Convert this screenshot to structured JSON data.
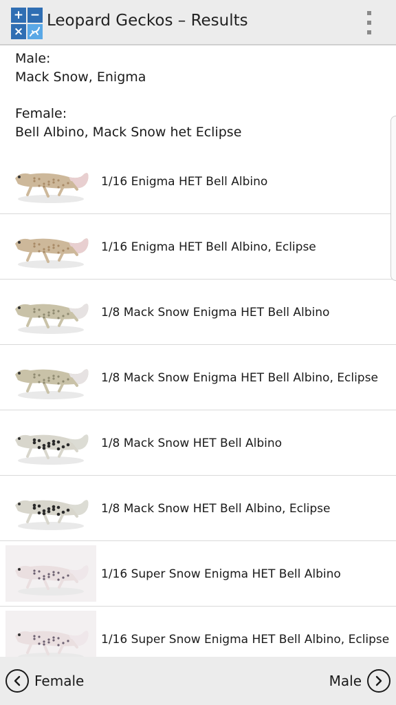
{
  "header": {
    "title": "Leopard Geckos – Results",
    "icon_glyphs": [
      "+",
      "−",
      "×",
      ""
    ],
    "menu_icon": "overflow-menu-icon"
  },
  "parents": {
    "male_label": "Male:",
    "male_value": "Mack Snow, Enigma",
    "female_label": "Female:",
    "female_value": "Bell Albino, Mack Snow het Eclipse"
  },
  "results": [
    {
      "label": "1/16 Enigma HET Bell Albino",
      "morph": "enigma-albino"
    },
    {
      "label": "1/16 Enigma HET Bell Albino, Eclipse",
      "morph": "enigma-albino"
    },
    {
      "label": "1/8 Mack Snow Enigma HET Bell Albino",
      "morph": "mack-snow-enigma"
    },
    {
      "label": "1/8 Mack Snow Enigma HET Bell Albino, Eclipse",
      "morph": "mack-snow-enigma"
    },
    {
      "label": "1/8 Mack Snow HET Bell Albino",
      "morph": "mack-snow"
    },
    {
      "label": "1/8 Mack Snow HET Bell Albino, Eclipse",
      "morph": "mack-snow"
    },
    {
      "label": "1/16 Super Snow Enigma HET Bell Albino",
      "morph": "super-snow-enigma"
    },
    {
      "label": "1/16 Super Snow Enigma HET Bell Albino, Eclipse",
      "morph": "super-snow-enigma"
    }
  ],
  "footer": {
    "prev_label": "Female",
    "next_label": "Male"
  },
  "colors": {
    "action_bar": "#ececec",
    "icon_dark": "#2f6eb3",
    "icon_light": "#5aa8e6",
    "divider": "#d9d9d9"
  }
}
